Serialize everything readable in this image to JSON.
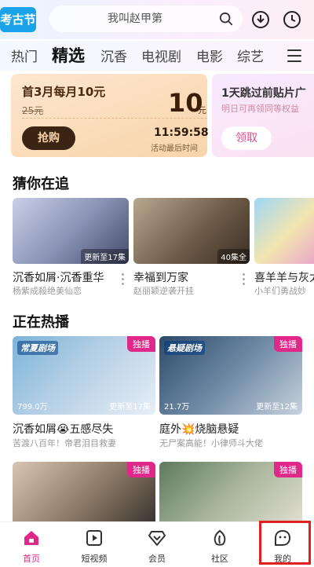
{
  "header": {
    "logo_text": "考古节",
    "search_placeholder": "我叫赵甲第"
  },
  "tabs": [
    "热门",
    "精选",
    "沉香",
    "电视剧",
    "电影",
    "综艺"
  ],
  "promo": {
    "title": "首3月每月10元",
    "original_price": "25元",
    "price": "10",
    "price_unit": "元",
    "buy_label": "抢购",
    "countdown": "11:59:58",
    "countdown_note": "活动最后时间",
    "side_title": "1天跳过前贴片广",
    "side_subtitle": "明日可再领同等权益",
    "side_button": "领取"
  },
  "sections": {
    "continue": "猜你在追",
    "hot": "正在热播"
  },
  "continue_items": [
    {
      "title": "沉香如屑·沉香重华",
      "subtitle": "杨紫成殺绝美仙恋",
      "badge": "更新至17集"
    },
    {
      "title": "幸福到万家",
      "subtitle": "赵丽颖逆袭开挂",
      "badge": "40集全"
    },
    {
      "title": "喜羊羊与灰太",
      "subtitle": "小羊们勇战妙",
      "badge": ""
    }
  ],
  "hot_items": [
    {
      "tag": "独播",
      "logo": "常夏剧场",
      "views": "799.0万",
      "update": "更新至17集",
      "title": "沉香如屑😭五感尽失",
      "subtitle": "苦渡八百年！帝君泪目救妻"
    },
    {
      "tag": "独播",
      "logo": "悬疑剧场",
      "views": "21.7万",
      "update": "更新至12集",
      "title": "庭外💥烧脑悬疑",
      "subtitle": "无尸案高能！小律师斗大佬"
    },
    {
      "tag": "独播",
      "logo": "",
      "views": "",
      "update": "",
      "title": "",
      "subtitle": ""
    },
    {
      "tag": "独播",
      "logo": "",
      "views": "",
      "update": "",
      "title": "",
      "subtitle": ""
    }
  ],
  "bottom_nav": [
    {
      "label": "首页",
      "icon": "home-icon",
      "active": true
    },
    {
      "label": "短视频",
      "icon": "play-square-icon",
      "active": false
    },
    {
      "label": "会员",
      "icon": "diamond-icon",
      "active": false
    },
    {
      "label": "社区",
      "icon": "leaf-icon",
      "active": false
    },
    {
      "label": "我的",
      "icon": "profile-face-icon",
      "active": false
    }
  ],
  "colors": {
    "accent": "#e0288a",
    "highlight": "#e02020"
  }
}
